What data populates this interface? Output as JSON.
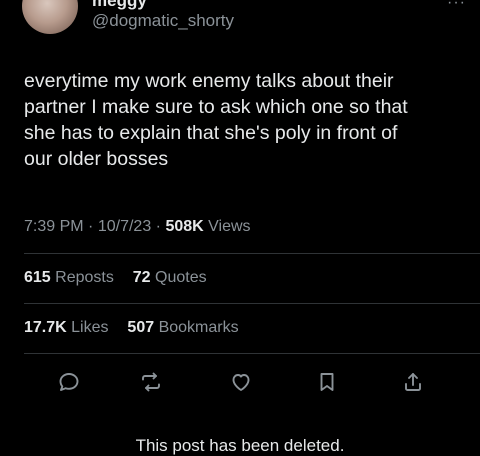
{
  "author": {
    "display_name": "meggy",
    "handle": "@dogmatic_shorty"
  },
  "post": {
    "lines": [
      "everytime my work enemy talks about their",
      "partner I make sure to ask which one so that",
      "she has to explain that she's poly in front of",
      "our older bosses"
    ]
  },
  "meta": {
    "time": "7:39 PM",
    "separator": "·",
    "date": "10/7/23",
    "views_count": "508K",
    "views_label": "Views"
  },
  "stats": {
    "reposts_count": "615",
    "reposts_label": "Reposts",
    "quotes_count": "72",
    "quotes_label": "Quotes",
    "likes_count": "17.7K",
    "likes_label": "Likes",
    "bookmarks_count": "507",
    "bookmarks_label": "Bookmarks"
  },
  "actions": {
    "icons": [
      "reply-icon",
      "repost-icon",
      "like-icon",
      "bookmark-icon",
      "share-icon"
    ]
  },
  "footer": {
    "deleted_notice": "This post has been deleted."
  },
  "colors": {
    "background": "#000000",
    "text": "#e7e9ea",
    "muted": "#8b9298",
    "divider": "#2f3336"
  }
}
